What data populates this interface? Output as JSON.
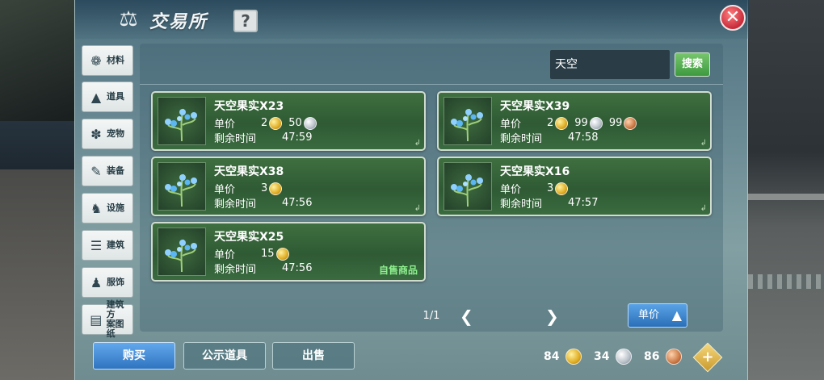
{
  "window": {
    "title": "交易所",
    "help_label": "?",
    "close_label": "✕"
  },
  "sidebar": {
    "items": [
      {
        "label": "材料",
        "icon": "materials-icon"
      },
      {
        "label": "道具",
        "icon": "props-icon"
      },
      {
        "label": "宠物",
        "icon": "pet-paw-icon"
      },
      {
        "label": "装备",
        "icon": "equipment-icon"
      },
      {
        "label": "设施",
        "icon": "facility-icon"
      },
      {
        "label": "建筑",
        "icon": "building-icon"
      },
      {
        "label": "服饰",
        "icon": "clothing-icon"
      },
      {
        "label_line1": "建筑方",
        "label_line2": "案图纸",
        "icon": "blueprint-icon"
      }
    ]
  },
  "search": {
    "value": "天空",
    "button_label": "搜索"
  },
  "listings": [
    {
      "name": "天空果实X23",
      "price_label": "单价",
      "price": [
        {
          "amount": "2",
          "coin": "gold"
        },
        {
          "amount": "50",
          "coin": "silver"
        }
      ],
      "time_label": "剩余时间",
      "time": "47:59",
      "self_sell": ""
    },
    {
      "name": "天空果实X39",
      "price_label": "单价",
      "price": [
        {
          "amount": "2",
          "coin": "gold"
        },
        {
          "amount": "99",
          "coin": "silver"
        },
        {
          "amount": "99",
          "coin": "copper"
        }
      ],
      "time_label": "剩余时间",
      "time": "47:58",
      "self_sell": ""
    },
    {
      "name": "天空果实X38",
      "price_label": "单价",
      "price": [
        {
          "amount": "3",
          "coin": "gold"
        }
      ],
      "time_label": "剩余时间",
      "time": "47:56",
      "self_sell": ""
    },
    {
      "name": "天空果实X16",
      "price_label": "单价",
      "price": [
        {
          "amount": "3",
          "coin": "gold"
        }
      ],
      "time_label": "剩余时间",
      "time": "47:57",
      "self_sell": ""
    },
    {
      "name": "天空果实X25",
      "price_label": "单价",
      "price": [
        {
          "amount": "15",
          "coin": "gold"
        }
      ],
      "time_label": "剩余时间",
      "time": "47:56",
      "self_sell": "自售商品"
    }
  ],
  "pager": {
    "text": "1/1",
    "prev": "❮",
    "next": "❯"
  },
  "sort": {
    "label": "单价",
    "arrow": "▲"
  },
  "bottom": {
    "buy_label": "购买",
    "show_label": "公示道具",
    "sell_label": "出售"
  },
  "wallet": {
    "gold": "84",
    "silver": "34",
    "copper": "86",
    "add_label": "+"
  },
  "colors": {
    "card_green": "#3a6b3f",
    "accent_blue": "#2f74c0",
    "search_green": "#3e9a3f",
    "close_red": "#c62b3a"
  }
}
